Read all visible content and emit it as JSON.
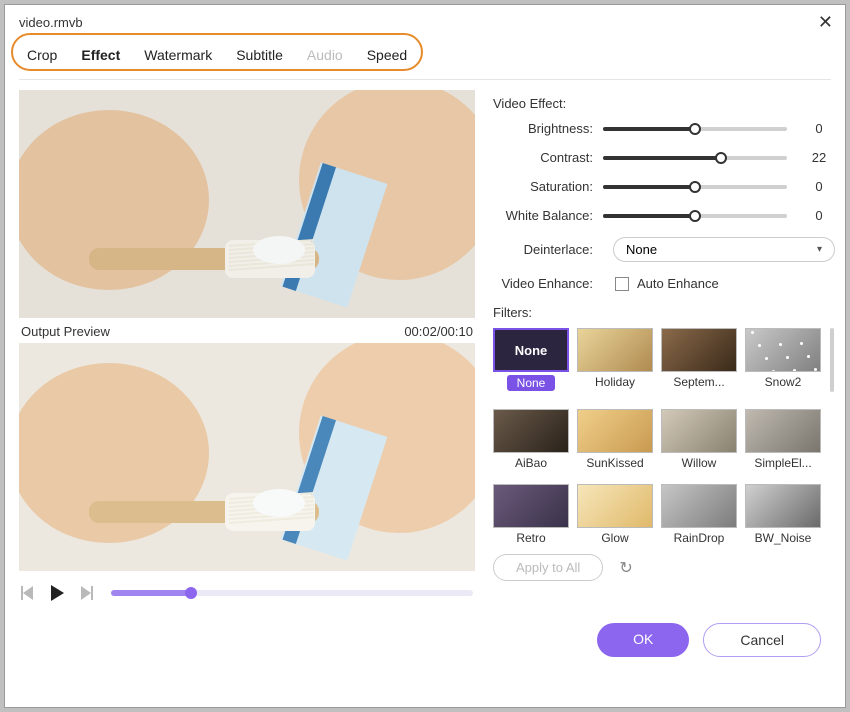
{
  "window": {
    "title": "video.rmvb"
  },
  "tabs": [
    {
      "label": "Crop",
      "active": false,
      "disabled": false
    },
    {
      "label": "Effect",
      "active": true,
      "disabled": false
    },
    {
      "label": "Watermark",
      "active": false,
      "disabled": false
    },
    {
      "label": "Subtitle",
      "active": false,
      "disabled": false
    },
    {
      "label": "Audio",
      "active": false,
      "disabled": true
    },
    {
      "label": "Speed",
      "active": false,
      "disabled": false
    }
  ],
  "preview": {
    "output_label": "Output Preview",
    "timecode": "00:02/00:10",
    "timeline_progress_pct": 22
  },
  "effects": {
    "section_label": "Video Effect:",
    "params": [
      {
        "key": "brightness",
        "label": "Brightness:",
        "value": 0,
        "pct": 50
      },
      {
        "key": "contrast",
        "label": "Contrast:",
        "value": 22,
        "pct": 64
      },
      {
        "key": "saturation",
        "label": "Saturation:",
        "value": 0,
        "pct": 50
      },
      {
        "key": "white_balance",
        "label": "White Balance:",
        "value": 0,
        "pct": 50
      }
    ],
    "deinterlace": {
      "label": "Deinterlace:",
      "selected": "None"
    },
    "video_enhance": {
      "label": "Video Enhance:",
      "option_label": "Auto Enhance",
      "checked": false
    }
  },
  "filters": {
    "label": "Filters:",
    "items": [
      {
        "name": "None",
        "key": "none",
        "selected": true
      },
      {
        "name": "Holiday",
        "key": "holiday",
        "selected": false
      },
      {
        "name": "Septem...",
        "key": "septem",
        "selected": false
      },
      {
        "name": "Snow2",
        "key": "snow2",
        "selected": false
      },
      {
        "name": "AiBao",
        "key": "aibao",
        "selected": false
      },
      {
        "name": "SunKissed",
        "key": "sunkissed",
        "selected": false
      },
      {
        "name": "Willow",
        "key": "willow",
        "selected": false
      },
      {
        "name": "SimpleEl...",
        "key": "simpleel",
        "selected": false
      },
      {
        "name": "Retro",
        "key": "retro",
        "selected": false
      },
      {
        "name": "Glow",
        "key": "glow",
        "selected": false
      },
      {
        "name": "RainDrop",
        "key": "raindrop",
        "selected": false
      },
      {
        "name": "BW_Noise",
        "key": "bwnoise",
        "selected": false
      }
    ],
    "apply_all_label": "Apply to All"
  },
  "footer": {
    "ok": "OK",
    "cancel": "Cancel"
  }
}
